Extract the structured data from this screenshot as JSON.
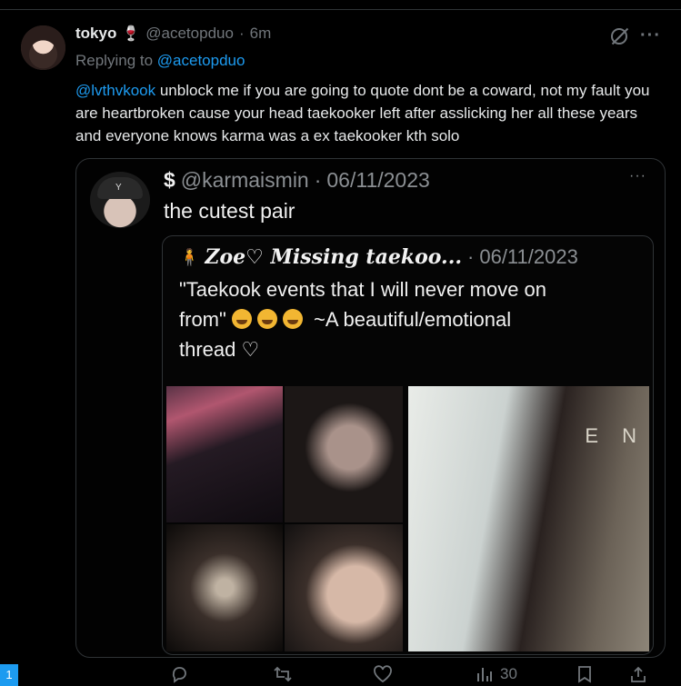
{
  "tweet": {
    "author_name": "tokyo",
    "author_emoji": "🍷",
    "handle": "@acetopduo",
    "separator": "·",
    "time": "6m",
    "replying_prefix": "Replying to",
    "replying_handle": "@acetopduo",
    "mention": "@lvthvkook",
    "text": " unblock me if you are going to quote dont be a coward, not my fault you are heartbroken cause your head taekooker left after asslicking her all these years and everyone knows karma was a ex taekooker kth solo"
  },
  "quote": {
    "author_name": "$",
    "handle": "@karmaismin",
    "separator": "·",
    "date": "06/11/2023",
    "text": "the cutest pair",
    "more": "···",
    "inner": {
      "emoji": "🧍",
      "author_name": "Zoe♡ Missing taekoo...",
      "separator": "·",
      "date": "06/11/2023",
      "text_line1": "\"Taekook events that I will never move on",
      "text_line2_pre": "from\"",
      "text_line2_post": " ~A beautiful/emotional",
      "text_line3": "thread ♡",
      "photo_letters": "E N"
    }
  },
  "actions": {
    "reply_icon": "reply-icon",
    "retweet_icon": "retweet-icon",
    "like_icon": "heart-icon",
    "views_icon": "views-icon",
    "views_count": "30",
    "bookmark_icon": "bookmark-icon",
    "share_icon": "share-icon"
  },
  "notification_badge": "1",
  "colors": {
    "accent": "#1d9bf0",
    "background": "#000000",
    "muted": "#71767b"
  }
}
